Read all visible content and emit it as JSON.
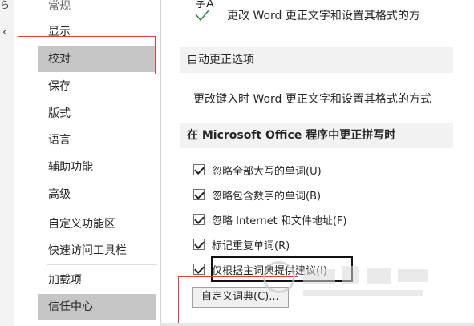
{
  "edge": {
    "text": "ら",
    "chevron": "‹"
  },
  "nav": {
    "items": [
      {
        "label": "常规"
      },
      {
        "label": "显示"
      },
      {
        "label": "校对"
      },
      {
        "label": "保存"
      },
      {
        "label": "版式"
      },
      {
        "label": "语言"
      },
      {
        "label": "辅助功能"
      },
      {
        "label": "高级"
      },
      {
        "label": "自定义功能区"
      },
      {
        "label": "快速访问工具栏"
      },
      {
        "label": "加载项"
      },
      {
        "label": "信任中心"
      }
    ],
    "selected": "校对"
  },
  "main": {
    "top_desc": "更改 Word 更正文字和设置其格式的方",
    "top_icon_letters": "字A",
    "autocorrect": {
      "header": "自动更正选项",
      "desc": "更改键入时 Word 更正文字和设置其格式的方式"
    },
    "office_spelling": {
      "header": "在 Microsoft Office 程序中更正拼写时",
      "options": [
        {
          "label": "忽略全部大写的单词(U)",
          "checked": true
        },
        {
          "label": "忽略包含数字的单词(B)",
          "checked": true
        },
        {
          "label": "忽略 Internet 和文件地址(F)",
          "checked": true
        },
        {
          "label": "标记重复单词(R)",
          "checked": true
        },
        {
          "label": "仅根据主词典提供建议(I)",
          "checked": true
        }
      ],
      "button": "自定义词典(C)..."
    }
  },
  "colors": {
    "highlight": "#e03c3c",
    "selected_bg": "#c6c6c6",
    "section_bg": "#f2f2f2"
  }
}
